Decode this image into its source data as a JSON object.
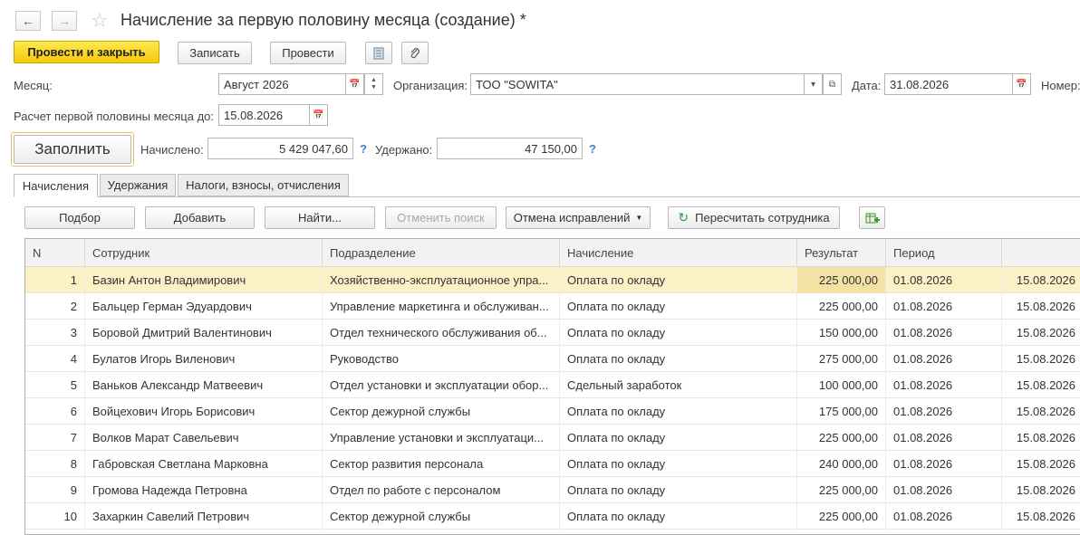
{
  "header": {
    "title": "Начисление за первую половину месяца (создание) *",
    "back_icon": "arrow-left",
    "forward_icon": "arrow-right",
    "favorite_icon": "star"
  },
  "toolbar": {
    "post_close_label": "Провести и закрыть",
    "save_label": "Записать",
    "post_label": "Провести",
    "report_icon": "document-icon",
    "attach_icon": "paperclip-icon"
  },
  "form": {
    "month_label": "Месяц:",
    "month_value": "Август 2026",
    "org_label": "Организация:",
    "org_value": "ТОО \"SOWITA\"",
    "date_label": "Дата:",
    "date_value": "31.08.2026",
    "number_label": "Номер:",
    "calc_until_label": "Расчет первой половины месяца до:",
    "calc_until_value": "15.08.2026",
    "fill_label": "Заполнить",
    "accrued_label": "Начислено:",
    "accrued_value": "5 429 047,60",
    "withheld_label": "Удержано:",
    "withheld_value": "47 150,00",
    "help_mark": "?"
  },
  "tabs": [
    {
      "label": "Начисления",
      "active": true
    },
    {
      "label": "Удержания",
      "active": false
    },
    {
      "label": "Налоги, взносы, отчисления",
      "active": false
    }
  ],
  "table_toolbar": {
    "select_label": "Подбор",
    "add_label": "Добавить",
    "find_label": "Найти...",
    "cancel_search_label": "Отменить поиск",
    "cancel_corrections_label": "Отмена исправлений",
    "recalc_label": "Пересчитать сотрудника"
  },
  "table": {
    "columns": [
      "N",
      "Сотрудник",
      "Подразделение",
      "Начисление",
      "Результат",
      "Период",
      ""
    ],
    "rows": [
      {
        "n": "1",
        "employee": "Базин Антон Владимирович",
        "dept": "Хозяйственно-эксплуатационное упра...",
        "accrual": "Оплата по окладу",
        "result": "225 000,00",
        "period_from": "01.08.2026",
        "period_to": "15.08.2026"
      },
      {
        "n": "2",
        "employee": "Бальцер Герман Эдуардович",
        "dept": "Управление маркетинга и обслуживан...",
        "accrual": "Оплата по окладу",
        "result": "225 000,00",
        "period_from": "01.08.2026",
        "period_to": "15.08.2026"
      },
      {
        "n": "3",
        "employee": "Боровой Дмитрий Валентинович",
        "dept": "Отдел технического обслуживания об...",
        "accrual": "Оплата по окладу",
        "result": "150 000,00",
        "period_from": "01.08.2026",
        "period_to": "15.08.2026"
      },
      {
        "n": "4",
        "employee": "Булатов Игорь Виленович",
        "dept": "Руководство",
        "accrual": "Оплата по окладу",
        "result": "275 000,00",
        "period_from": "01.08.2026",
        "period_to": "15.08.2026"
      },
      {
        "n": "5",
        "employee": "Ваньков Александр Матвеевич",
        "dept": "Отдел установки и эксплуатации обор...",
        "accrual": "Сдельный заработок",
        "result": "100 000,00",
        "period_from": "01.08.2026",
        "period_to": "15.08.2026"
      },
      {
        "n": "6",
        "employee": "Войцехович Игорь Борисович",
        "dept": "Сектор дежурной службы",
        "accrual": "Оплата по окладу",
        "result": "175 000,00",
        "period_from": "01.08.2026",
        "period_to": "15.08.2026"
      },
      {
        "n": "7",
        "employee": "Волков Марат Савельевич",
        "dept": "Управление установки и эксплуатаци...",
        "accrual": "Оплата по окладу",
        "result": "225 000,00",
        "period_from": "01.08.2026",
        "period_to": "15.08.2026"
      },
      {
        "n": "8",
        "employee": "Габровская Светлана Марковна",
        "dept": "Сектор развития персонала",
        "accrual": "Оплата по окладу",
        "result": "240 000,00",
        "period_from": "01.08.2026",
        "period_to": "15.08.2026"
      },
      {
        "n": "9",
        "employee": "Громова Надежда Петровна",
        "dept": "Отдел по работе с персоналом",
        "accrual": "Оплата по окладу",
        "result": "225 000,00",
        "period_from": "01.08.2026",
        "period_to": "15.08.2026"
      },
      {
        "n": "10",
        "employee": "Захаркин Савелий Петрович",
        "dept": "Сектор дежурной службы",
        "accrual": "Оплата по окладу",
        "result": "225 000,00",
        "period_from": "01.08.2026",
        "period_to": "15.08.2026"
      }
    ]
  },
  "colors": {
    "primary_button": "#f5c90a",
    "selected_row": "#fbf0c6",
    "help_mark": "#3b7fd0",
    "recalc_icon": "#2e9a3a"
  }
}
